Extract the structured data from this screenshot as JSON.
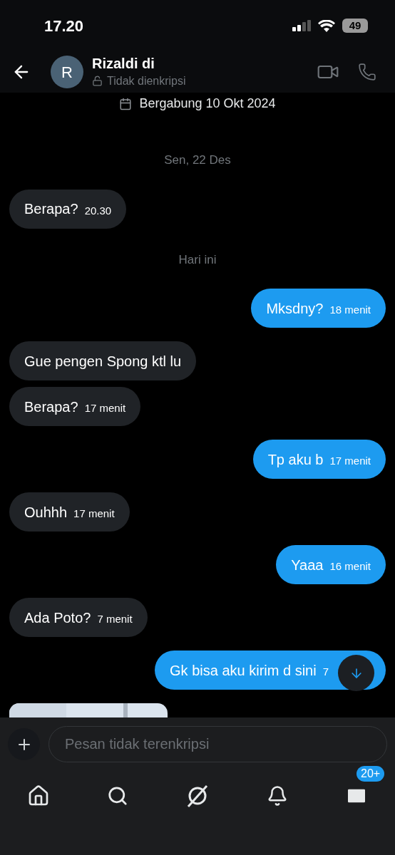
{
  "status_bar": {
    "time": "17.20",
    "battery": "49"
  },
  "header": {
    "avatar_letter": "R",
    "name": "Rizaldi di",
    "encryption": "Tidak dienkripsi"
  },
  "joined": "Bergabung 10 Okt 2024",
  "messages": [
    {
      "kind": "date",
      "text": "Sen, 22 Des"
    },
    {
      "kind": "received",
      "text": "Berapa?",
      "time": "20.30"
    },
    {
      "kind": "date",
      "text": "Hari ini"
    },
    {
      "kind": "sent",
      "text": "Mksdny?",
      "time": "18 menit"
    },
    {
      "kind": "received",
      "text": "Gue pengen Spong ktl lu"
    },
    {
      "kind": "received",
      "text": "Berapa?",
      "time": "17 menit"
    },
    {
      "kind": "sent",
      "text": "Tp aku b",
      "time": "17 menit"
    },
    {
      "kind": "received",
      "text": "Ouhhh",
      "time": "17 menit"
    },
    {
      "kind": "sent",
      "text": "Yaaa",
      "time": "16 menit"
    },
    {
      "kind": "received",
      "text": "Ada Poto?",
      "time": "7 menit"
    },
    {
      "kind": "sent",
      "text": "Gk bisa aku kirim d sini",
      "time": "7"
    },
    {
      "kind": "picture"
    }
  ],
  "composer": {
    "placeholder": "Pesan tidak terenkripsi"
  },
  "nav": {
    "badge": "20+"
  }
}
